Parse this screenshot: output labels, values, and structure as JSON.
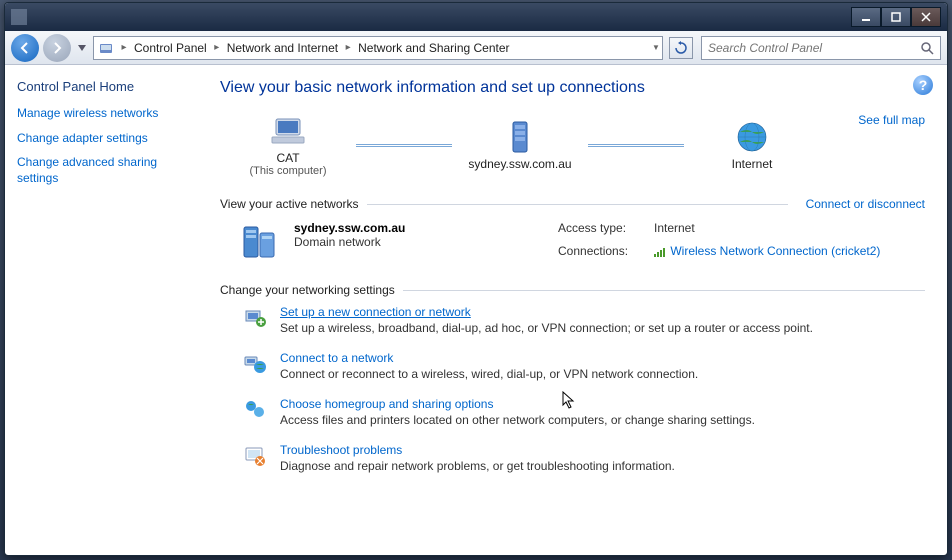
{
  "titlebar": {
    "min": "−",
    "max": "▢",
    "close": "✕"
  },
  "nav": {
    "breadcrumb": [
      "Control Panel",
      "Network and Internet",
      "Network and Sharing Center"
    ]
  },
  "search": {
    "placeholder": "Search Control Panel"
  },
  "sidebar": {
    "title": "Control Panel Home",
    "links": [
      "Manage wireless networks",
      "Change adapter settings",
      "Change advanced sharing settings"
    ]
  },
  "main": {
    "title": "View your basic network information and set up connections",
    "map": {
      "full_map_link": "See full map",
      "nodes": [
        {
          "label": "CAT",
          "sub": "(This computer)"
        },
        {
          "label": "sydney.ssw.com.au",
          "sub": ""
        },
        {
          "label": "Internet",
          "sub": ""
        }
      ]
    },
    "active": {
      "heading": "View your active networks",
      "right_link": "Connect or disconnect",
      "network": {
        "name": "sydney.ssw.com.au",
        "type": "Domain network",
        "access_label": "Access type:",
        "access_value": "Internet",
        "conn_label": "Connections:",
        "conn_link": "Wireless Network Connection (cricket2)"
      }
    },
    "change": {
      "heading": "Change your networking settings",
      "tasks": [
        {
          "title": "Set up a new connection or network",
          "desc": "Set up a wireless, broadband, dial-up, ad hoc, or VPN connection; or set up a router or access point."
        },
        {
          "title": "Connect to a network",
          "desc": "Connect or reconnect to a wireless, wired, dial-up, or VPN network connection."
        },
        {
          "title": "Choose homegroup and sharing options",
          "desc": "Access files and printers located on other network computers, or change sharing settings."
        },
        {
          "title": "Troubleshoot problems",
          "desc": "Diagnose and repair network problems, or get troubleshooting information."
        }
      ]
    }
  }
}
